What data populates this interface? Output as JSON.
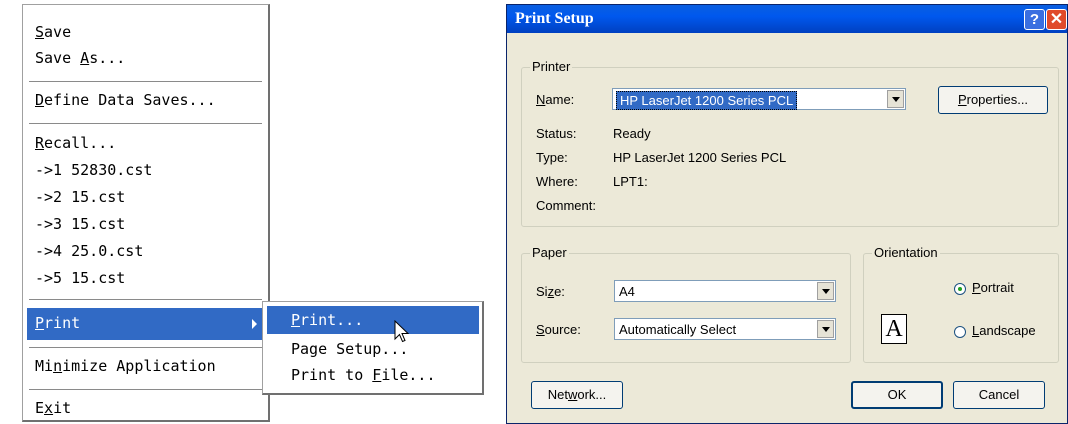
{
  "file_menu": {
    "save": {
      "ul": "S",
      "rest": "ave"
    },
    "save_as": {
      "pre": "Save ",
      "ul": "A",
      "rest": "s..."
    },
    "define_data_saves": {
      "ul": "D",
      "rest": "efine Data Saves..."
    },
    "recall": {
      "ul": "R",
      "rest": "ecall..."
    },
    "recent_files": [
      "->1 52830.cst",
      "->2 15.cst",
      "->3 15.cst",
      "->4 25.0.cst",
      "->5 15.cst"
    ],
    "print": {
      "ul": "P",
      "rest": "rint"
    },
    "minimize": {
      "pre": "Mi",
      "ul": "n",
      "rest": "imize Application"
    },
    "exit": {
      "pre": "E",
      "ul": "x",
      "rest": "it"
    }
  },
  "print_submenu": {
    "print": {
      "ul": "P",
      "rest": "rint..."
    },
    "page_setup": "Page Setup...",
    "print_to_file": {
      "pre": "Print to ",
      "ul": "F",
      "rest": "ile..."
    }
  },
  "dialog": {
    "title": "Print Setup",
    "help_glyph": "?",
    "close_glyph": "✕",
    "printer_group": "Printer",
    "name_label": {
      "ul": "N",
      "rest": "ame:"
    },
    "name_value": "HP LaserJet 1200 Series PCL",
    "properties_button": {
      "ul": "P",
      "rest": "roperties..."
    },
    "status_label": "Status:",
    "status_value": "Ready",
    "type_label": "Type:",
    "type_value": "HP LaserJet 1200 Series PCL",
    "where_label": "Where:",
    "where_value": "LPT1:",
    "comment_label": "Comment:",
    "paper_group": "Paper",
    "size_label": {
      "pre": "Si",
      "ul": "z",
      "rest": "e:"
    },
    "size_value": "A4",
    "source_label": {
      "ul": "S",
      "rest": "ource:"
    },
    "source_value": "Automatically Select",
    "orientation_group": "Orientation",
    "orientation_glyph": "A",
    "portrait": {
      "ul": "P",
      "rest": "ortrait"
    },
    "landscape": {
      "ul": "L",
      "rest": "andscape"
    },
    "network_button": {
      "pre": "Net",
      "ul": "w",
      "rest": "ork..."
    },
    "ok_button": "OK",
    "cancel_button": "Cancel",
    "accent_color": "#316ac5",
    "orientation_selected": "Portrait"
  }
}
